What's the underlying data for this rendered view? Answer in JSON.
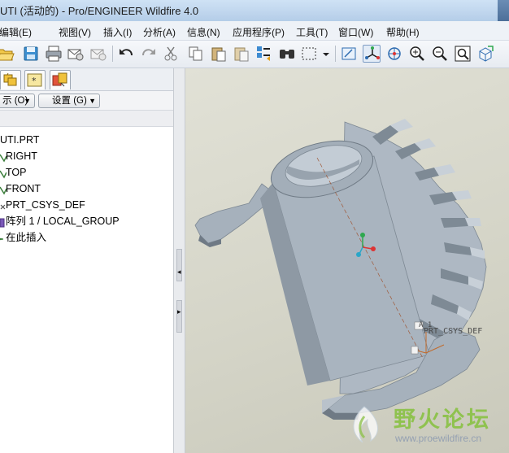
{
  "window": {
    "title": "UTI (活动的) - Pro/ENGINEER Wildfire 4.0"
  },
  "menu": {
    "items": [
      "编辑(E)",
      "视图(V)",
      "插入(I)",
      "分析(A)",
      "信息(N)",
      "应用程序(P)",
      "工具(T)",
      "窗口(W)",
      "帮助(H)"
    ]
  },
  "toolbar": {
    "icons": [
      "open-icon",
      "save-icon",
      "print-icon",
      "email-icon",
      "email-link-icon",
      "undo-icon",
      "redo-icon",
      "cut-icon",
      "copy-icon",
      "paste-icon",
      "paste-special-icon",
      "regenerate-icon",
      "find-icon",
      "select-box-icon",
      "dropdown-icon",
      "repaint-icon",
      "spin-center-icon",
      "orient-mode-icon",
      "zoom-in-icon",
      "zoom-out-icon",
      "refit-icon",
      "reorient-icon"
    ]
  },
  "model_tree": {
    "show_button": "示 (O)",
    "settings_button": "设置 (G)",
    "items": [
      "UTI.PRT",
      "RIGHT",
      "TOP",
      "FRONT",
      "PRT_CSYS_DEF",
      "阵列 1 / LOCAL_GROUP",
      "在此插入"
    ]
  },
  "graphics": {
    "csys_label": "PRT_CSYS_DEF",
    "axis_label": "A_1",
    "model_color": "#a9b4bf",
    "background_color": "#d6d6c9"
  },
  "watermark": {
    "text": "野火论坛",
    "url": "www.proewildfire.cn"
  }
}
